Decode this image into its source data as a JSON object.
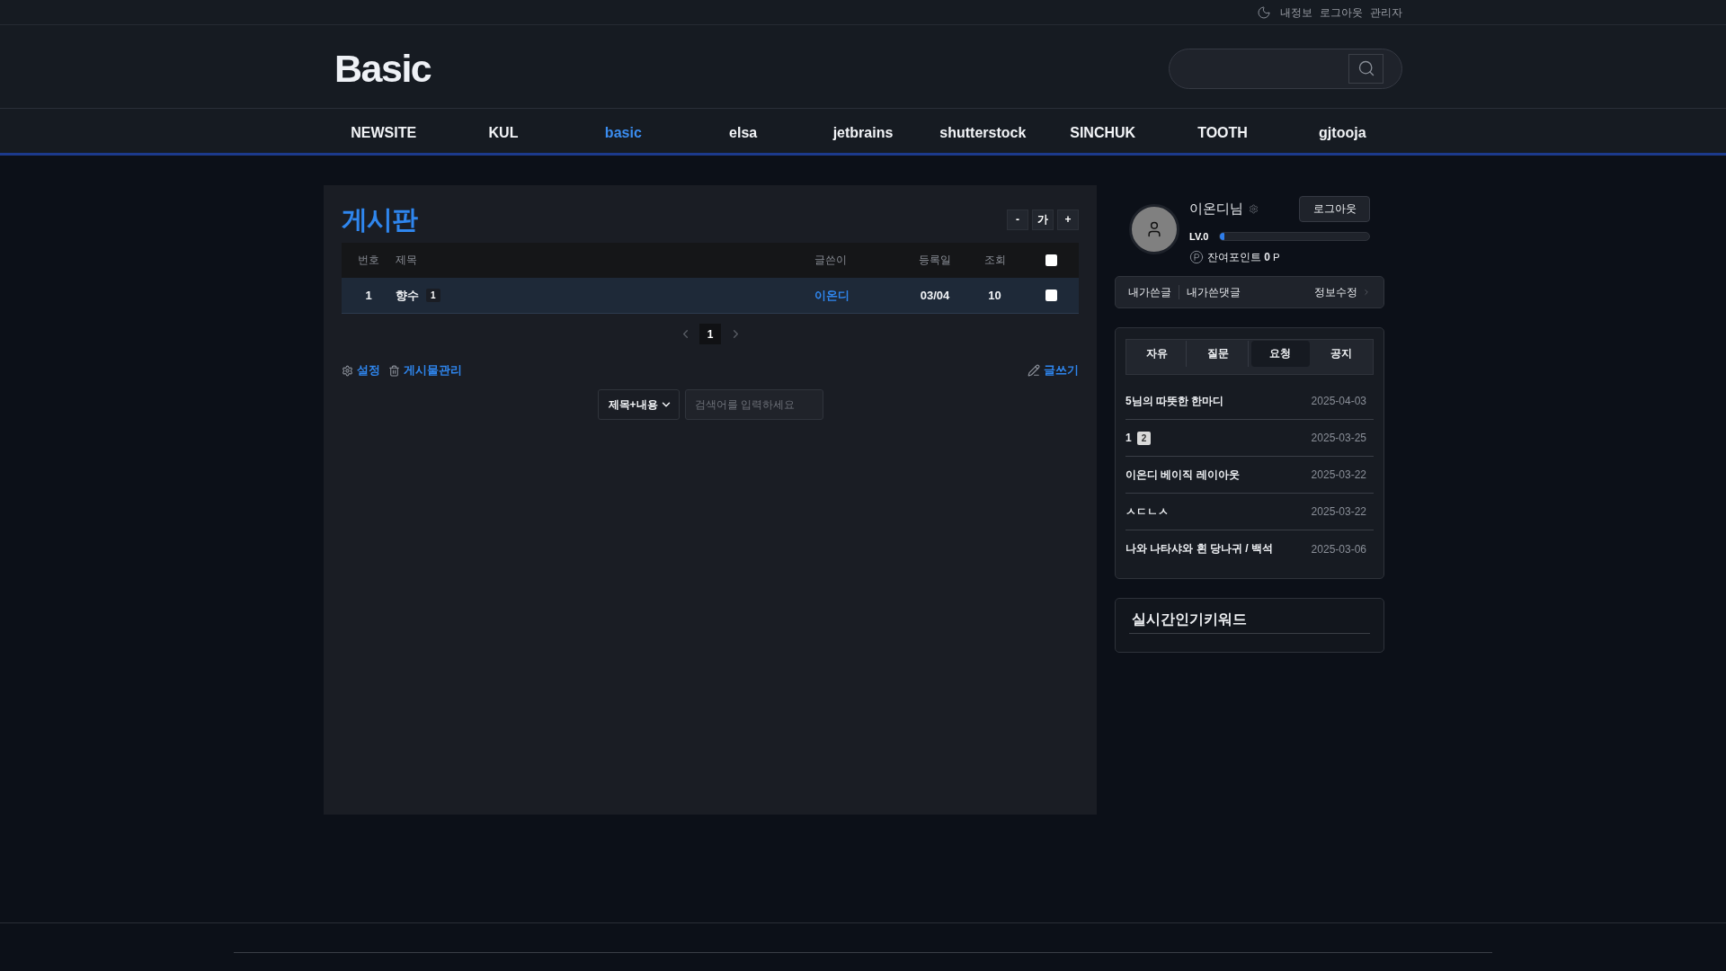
{
  "top_bar": {
    "links": [
      "내정보",
      "로그아웃",
      "관리자"
    ]
  },
  "header": {
    "logo": "Basic"
  },
  "nav": [
    {
      "label": "NEWSITE",
      "selected": false
    },
    {
      "label": "KUL",
      "selected": false
    },
    {
      "label": "basic",
      "selected": true
    },
    {
      "label": "elsa",
      "selected": false
    },
    {
      "label": "jetbrains",
      "selected": false
    },
    {
      "label": "shutterstock",
      "selected": false
    },
    {
      "label": "SINCHUK",
      "selected": false
    },
    {
      "label": "TOOTH",
      "selected": false
    },
    {
      "label": "gjtooja",
      "selected": false
    }
  ],
  "board": {
    "title": "게시판",
    "font_buttons": [
      "-",
      "가",
      "+"
    ],
    "columns": [
      "번호",
      "제목",
      "글쓴이",
      "등록일",
      "조회"
    ],
    "select_all": {
      "checked": false
    },
    "rows": [
      {
        "number": "1",
        "title": "향수",
        "comments": "1",
        "author": "이온디",
        "date": "03/04",
        "views": "10",
        "checked": false
      }
    ],
    "pages": [
      {
        "label": "1",
        "selected": true
      }
    ],
    "tools": [
      {
        "kind": "settings",
        "label": "설정"
      },
      {
        "kind": "manage",
        "label": "게시물관리"
      }
    ],
    "write": "글쓰기",
    "search": {
      "scope": "제목+내용",
      "placeholder": "검색어를 입력하세요"
    }
  },
  "profile": {
    "name": "이온디님",
    "logout": "로그아웃",
    "level_label": "LV.0",
    "level": 0.03,
    "points": "잔여포인트 **0** P",
    "links": [
      "내가쓴글",
      "내가쓴댓글"
    ],
    "edit": "정보수정"
  },
  "latest": {
    "tabs": [
      {
        "label": "자유",
        "selected": false
      },
      {
        "label": "질문",
        "selected": false
      },
      {
        "label": "요청",
        "selected": true
      },
      {
        "label": "공지",
        "selected": false
      }
    ],
    "posts": [
      {
        "title": "5님의 따뜻한 한마디",
        "date": "2025-04-03"
      },
      {
        "title": "1",
        "comments": "2",
        "date": "2025-03-25"
      },
      {
        "title": "이온디 베이직 레이아웃",
        "date": "2025-03-22"
      },
      {
        "title": "ㅅㄷㄴㅅ",
        "date": "2025-03-22"
      },
      {
        "title": "나와 나타샤와 흰 당나귀 / 백석",
        "date": "2025-03-06"
      }
    ]
  },
  "keywords": {
    "title": "실시간인기키워드"
  }
}
